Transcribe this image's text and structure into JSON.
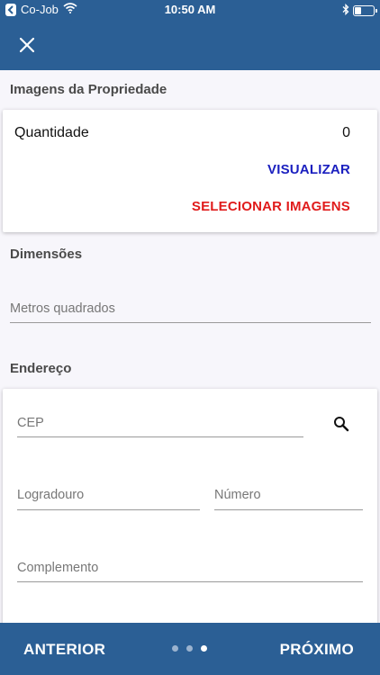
{
  "status_bar": {
    "back_app": "Co-Job",
    "time": "10:50 AM"
  },
  "images_section": {
    "title": "Imagens da Propriedade",
    "quantity_label": "Quantidade",
    "quantity_value": "0",
    "view_button": "VISUALIZAR",
    "select_button": "SELECIONAR IMAGENS"
  },
  "dimensions_section": {
    "title": "Dimensões",
    "area_placeholder": "Metros quadrados"
  },
  "address_section": {
    "title": "Endereço",
    "cep_placeholder": "CEP",
    "street_placeholder": "Logradouro",
    "number_placeholder": "Número",
    "complement_placeholder": "Complemento"
  },
  "pager": {
    "previous_label": "ANTERIOR",
    "next_label": "PRÓXIMO",
    "page_count": 3,
    "current_page": 3
  },
  "colors": {
    "primary": "#2b5f95",
    "view_link": "#1a1fbf",
    "select_link": "#e01b1b"
  }
}
